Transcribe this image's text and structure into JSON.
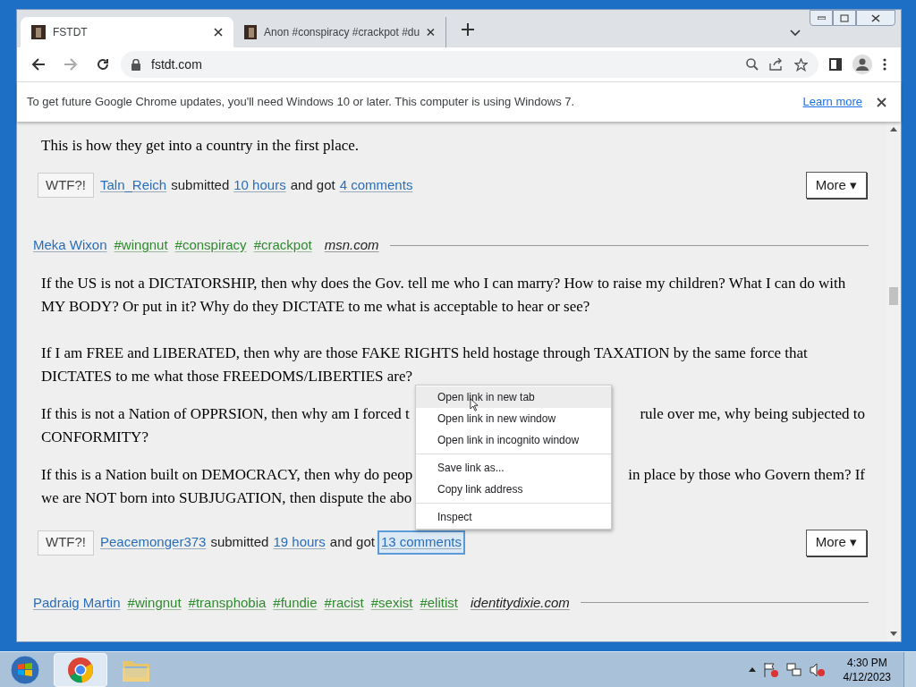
{
  "tabs": [
    {
      "title": "FSTDT",
      "selected": true
    },
    {
      "title": "Anon #conspiracy #crackpot #du",
      "selected": false
    }
  ],
  "address": "fstdt.com",
  "infobar": {
    "message": "To get future Google Chrome updates, you'll need Windows 10 or later. This computer is using Windows 7.",
    "link": "Learn more"
  },
  "posts": [
    {
      "paragraphs": [
        [
          [
            "This is how they get into a country in the first place."
          ]
        ]
      ],
      "rating": "WTF?!",
      "author": "Taln_Reich",
      "submitted": "submitted",
      "time": "10 hours",
      "got": "and got",
      "comments": "4 comments",
      "comments_focused": false,
      "more": "More ▾"
    },
    {
      "header": {
        "author": "Meka Wixon",
        "tags": [
          "#wingnut",
          "#conspiracy",
          "#crackpot"
        ],
        "source": "msn.com"
      },
      "paragraphs": [
        [
          [
            "If the US is not a DICTATORSHIP, then why does the Gov. tell me who I can marry? How to raise my children? What I can do with MY BODY? Or put in it? Why do they DICTATE to me what is acceptable to hear or see?"
          ]
        ],
        [
          [
            "If I am FREE and LIBERATED, then why are those FAKE RIGHTS held hostage through TAXATION by the same force that DICTATES to me what those FREEDOMS/LIBERTIES are?"
          ]
        ],
        [
          [
            "If this is not a Nation of OPPRSION, then why am I forced t",
            "rule over me, why being subjected to"
          ],
          [
            "CONFORMITY?"
          ]
        ],
        [
          [
            "If this is a Nation built on DEMOCRACY, then why do peop",
            "in place by those who Govern them? If"
          ],
          [
            "we are NOT born into SUBJUGATION, then dispute the abo"
          ]
        ]
      ],
      "rating": "WTF?!",
      "author": "Peacemonger373",
      "submitted": "submitted",
      "time": "19 hours",
      "got": "and got",
      "comments": "13 comments",
      "comments_focused": true,
      "more": "More ▾"
    },
    {
      "header": {
        "author": "Padraig Martin",
        "tags": [
          "#wingnut",
          "#transphobia",
          "#fundie",
          "#racist",
          "#sexist",
          "#elitist"
        ],
        "source": "identitydixie.com"
      }
    }
  ],
  "context_menu": {
    "groups": [
      [
        {
          "label": "Open link in new tab",
          "selected": true
        },
        {
          "label": "Open link in new window",
          "selected": false
        },
        {
          "label": "Open link in incognito window",
          "selected": false
        }
      ],
      [
        {
          "label": "Save link as...",
          "selected": false
        },
        {
          "label": "Copy link address",
          "selected": false
        }
      ],
      [
        {
          "label": "Inspect",
          "selected": false
        }
      ]
    ]
  },
  "clock": {
    "time": "4:30 PM",
    "date": "4/12/2023"
  }
}
